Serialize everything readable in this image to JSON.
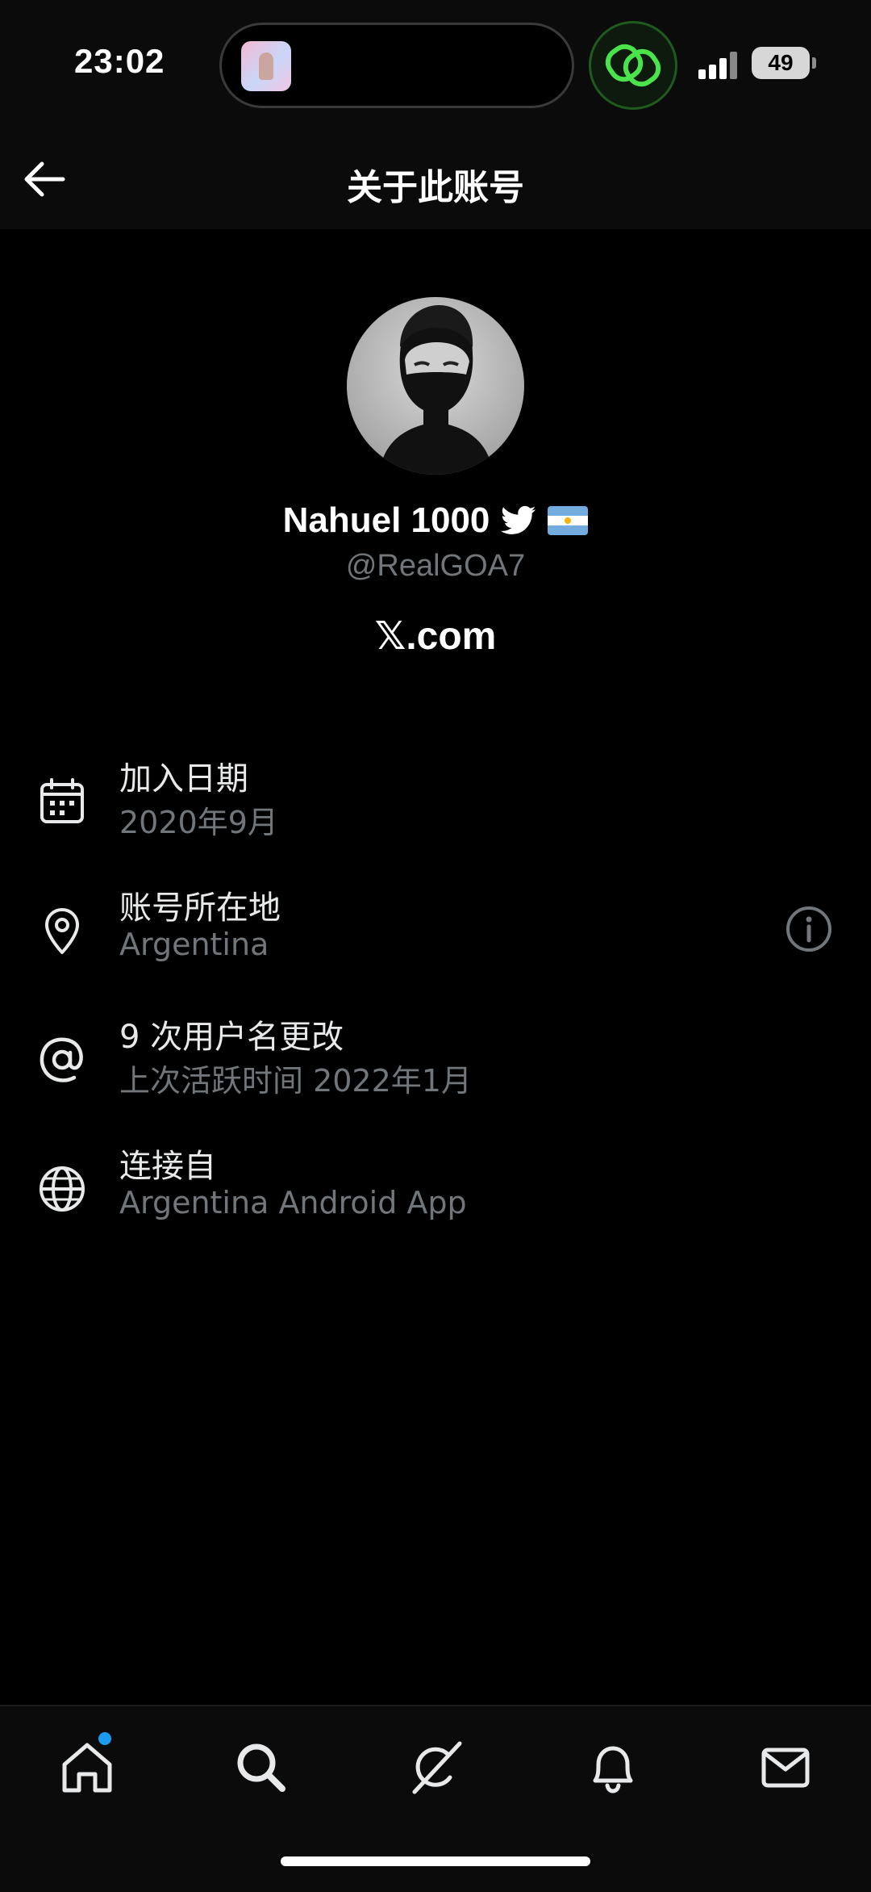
{
  "status_bar": {
    "time": "23:02",
    "battery": "49"
  },
  "header": {
    "title": "关于此账号"
  },
  "profile": {
    "display_name": "Nahuel 1000",
    "handle": "@RealGOA7",
    "source_site": "𝕏.com"
  },
  "info": [
    {
      "title": "加入日期",
      "sub": "2020年9月",
      "icon": "calendar-icon"
    },
    {
      "title": "账号所在地",
      "sub": "Argentina",
      "icon": "location-pin-icon",
      "action_icon": "info-icon"
    },
    {
      "title": "9 次用户名更改",
      "sub": "上次活跃时间 2022年1月",
      "icon": "at-sign-icon"
    },
    {
      "title": "连接自",
      "sub": "Argentina Android App",
      "icon": "globe-icon"
    }
  ],
  "nav": {
    "items": [
      "home-icon",
      "search-icon",
      "grok-icon",
      "bell-icon",
      "mail-icon"
    ],
    "accent": "#1d9bf0"
  },
  "colors": {
    "background": "#000000",
    "text_primary": "#e7e9ea",
    "text_secondary": "#71767b",
    "accent": "#1d9bf0"
  }
}
